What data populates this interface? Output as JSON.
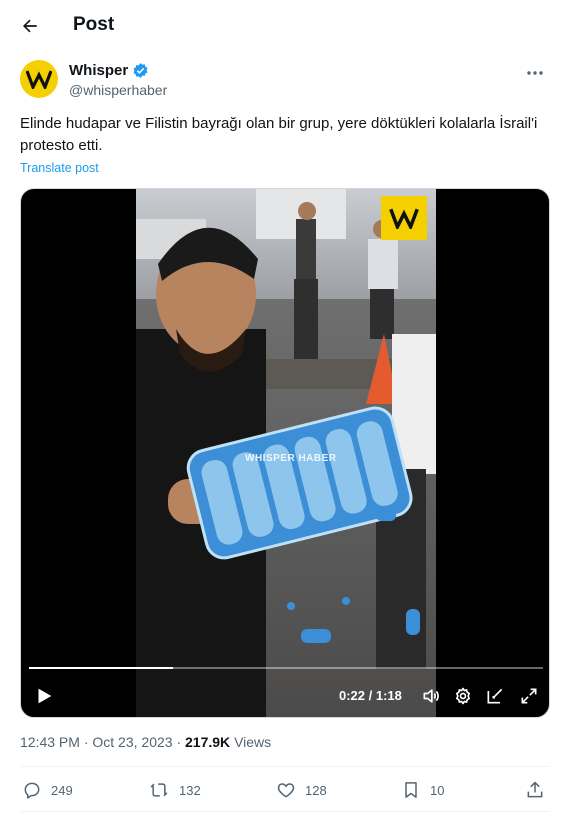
{
  "header": {
    "title": "Post"
  },
  "author": {
    "name": "Whisper",
    "handle": "@whisperhaber",
    "avatar_color": "#f5d000",
    "verified_color": "#1d9bf0"
  },
  "post": {
    "text": "Elinde hudapar ve Filistin bayrağı olan bir grup, yere döktükleri kolalarla İsrail'i protesto etti.",
    "translate_label": "Translate post"
  },
  "video": {
    "watermark": "WHISPER HABER",
    "time": "0:22 / 1:18",
    "progress": 0.28
  },
  "meta": {
    "time": "12:43 PM",
    "date": "Oct 23, 2023",
    "views_count": "217.9K",
    "views_label": "Views"
  },
  "actions": {
    "replies": "249",
    "reposts": "132",
    "likes": "128",
    "bookmarks": "10"
  },
  "colors": {
    "accent": "#1d9bf0",
    "secondary_text": "#536471"
  }
}
